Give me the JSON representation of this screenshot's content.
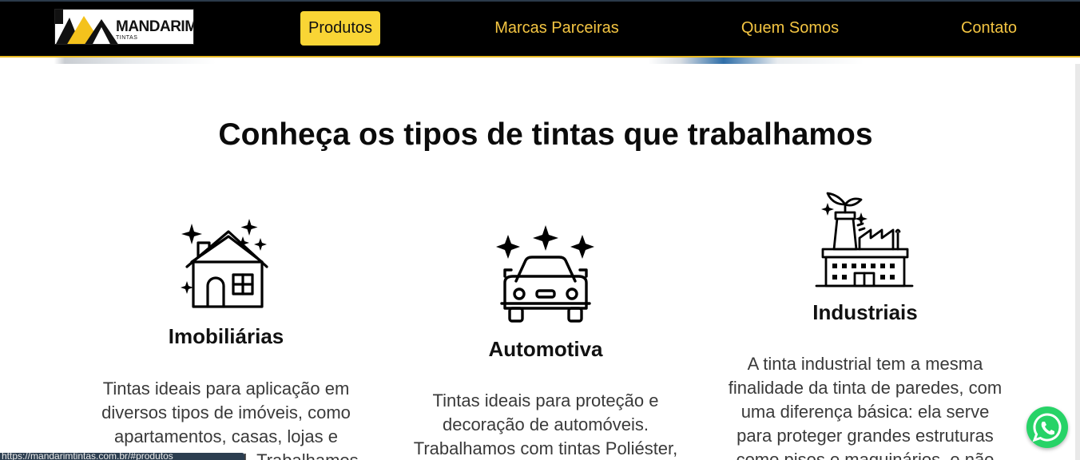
{
  "header": {
    "logo_text": "MANDARIM",
    "logo_sub": "TINTAS",
    "nav": [
      {
        "label": "Produtos",
        "active": true
      },
      {
        "label": "Marcas Parceiras",
        "active": false
      },
      {
        "label": "Quem Somos",
        "active": false
      },
      {
        "label": "Contato",
        "active": false
      }
    ]
  },
  "main": {
    "title": "Conheça os tipos de tintas que trabalhamos",
    "columns": [
      {
        "icon": "house-sparkle-icon",
        "title": "Imobiliárias",
        "lines": [
          "Tintas ideais para aplicação em",
          "diversos tipos de imóveis, como",
          "apartamentos, casas, lojas e",
          "escritórios em geral. Trabalhamos"
        ]
      },
      {
        "icon": "car-sparkle-icon",
        "title": "Automotiva",
        "lines": [
          "Tintas ideais para proteção e",
          "decoração de automóveis.",
          "Trabalhamos com tintas Poliéster,"
        ]
      },
      {
        "icon": "factory-icon",
        "title": "Industriais",
        "lines": [
          "A tinta industrial tem a mesma",
          "finalidade da tinta de paredes, com",
          "uma diferença básica: ela serve",
          "para proteger grandes estruturas",
          "como pisos e maquinários, e não"
        ]
      }
    ]
  },
  "status_bar": {
    "url": "https://mandarimtintas.com.br/#produtos"
  },
  "colors": {
    "accent": "#f9d535",
    "nav_text": "#f4c542",
    "whatsapp": "#27d367"
  }
}
